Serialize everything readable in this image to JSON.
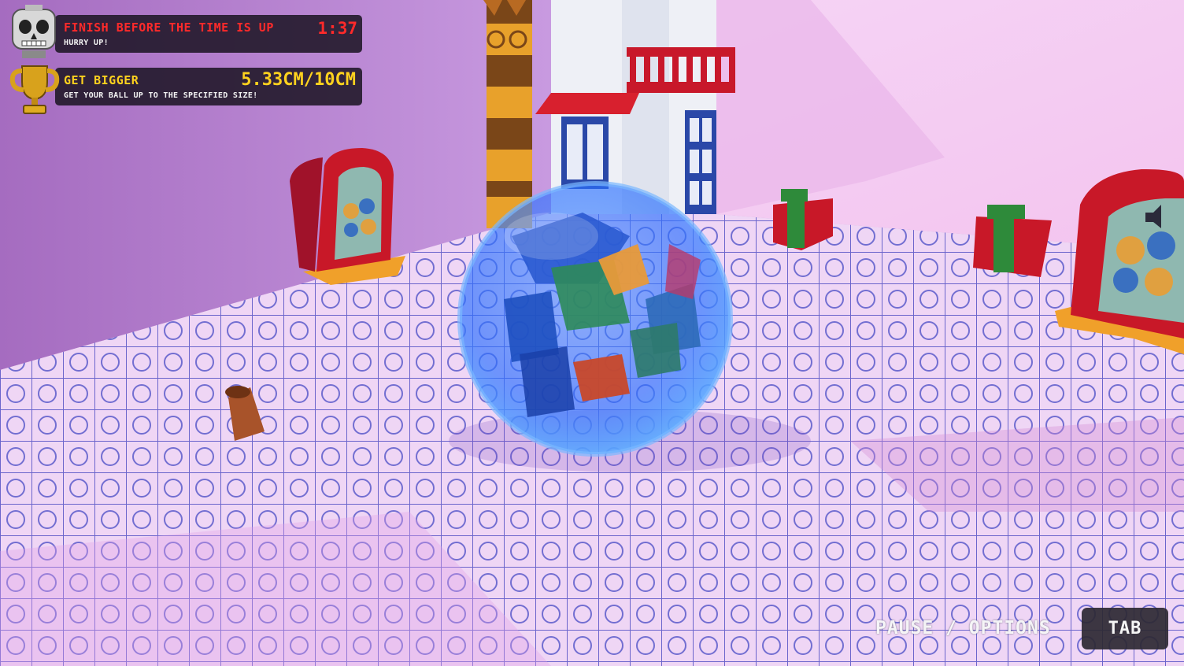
{
  "hud": {
    "timer_objective": {
      "title": "Finish before the time is up",
      "subtitle": "Hurry up!",
      "value": "1:37",
      "icon": "skull-icon",
      "title_color": "#ff2a2a",
      "value_color": "#ff2a2a"
    },
    "size_objective": {
      "title": "Get bigger",
      "subtitle": "Get your ball up to the specified size!",
      "value": "5.33CM/10CM",
      "icon": "trophy-icon",
      "title_color": "#ffd21e",
      "value_color": "#ffd21e"
    }
  },
  "controls": {
    "pause_label": "Pause / Options",
    "key_label": "TAB"
  }
}
